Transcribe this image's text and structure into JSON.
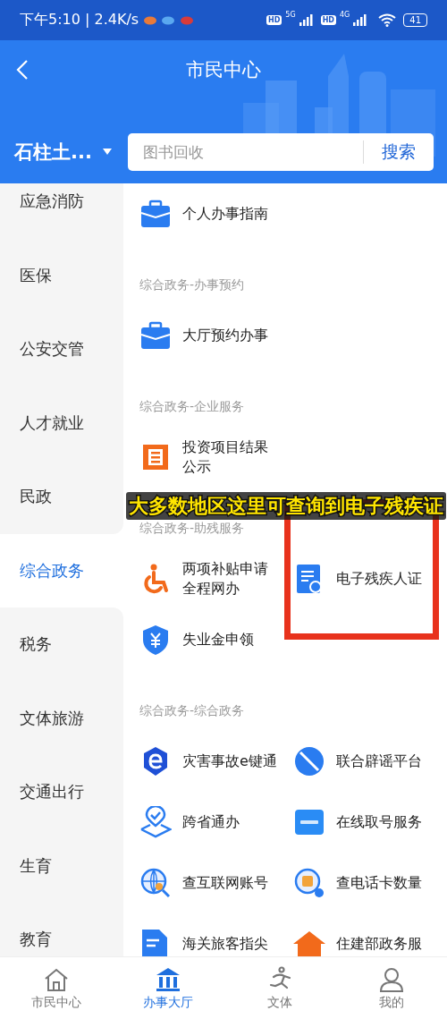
{
  "status_bar": {
    "time": "下午5:10 | 2.4K/s",
    "sim1_badge": "HD",
    "sim1_network": "5G",
    "sim2_badge": "HD",
    "sim2_network": "4G",
    "battery": "41"
  },
  "header": {
    "title": "市民中心",
    "location": "石柱土...",
    "search": {
      "placeholder": "图书回收",
      "button": "搜索"
    }
  },
  "sidebar": [
    {
      "label": "应急消防",
      "selected": false
    },
    {
      "label": "医保",
      "selected": false
    },
    {
      "label": "公安交管",
      "selected": false
    },
    {
      "label": "人才就业",
      "selected": false
    },
    {
      "label": "民政",
      "selected": false
    },
    {
      "label": "综合政务",
      "selected": true
    },
    {
      "label": "税务",
      "selected": false
    },
    {
      "label": "文体旅游",
      "selected": false
    },
    {
      "label": "交通出行",
      "selected": false
    },
    {
      "label": "生育",
      "selected": false
    },
    {
      "label": "教育",
      "selected": false
    }
  ],
  "sections": [
    {
      "items": [
        {
          "label": "个人办事指南",
          "highlighted": false
        }
      ]
    },
    {
      "header": "综合政务-办事预约",
      "items": [
        {
          "label": "大厅预约办事",
          "highlighted": false
        }
      ]
    },
    {
      "header": "综合政务-企业服务",
      "items": [
        {
          "label": "投资项目结果公示",
          "highlighted": false
        }
      ]
    },
    {
      "header": "综合政务-助残服务",
      "items": [
        {
          "label": "两项补贴申请全程网办",
          "highlighted": false
        },
        {
          "label": "电子残疾人证",
          "highlighted": true
        },
        {
          "label": "失业金申领",
          "highlighted": false
        }
      ]
    },
    {
      "header": "综合政务-综合政务",
      "items": [
        {
          "label": "灾害事故e键通",
          "highlighted": false
        },
        {
          "label": "联合辟谣平台",
          "highlighted": false
        },
        {
          "label": "跨省通办",
          "highlighted": false
        },
        {
          "label": "在线取号服务",
          "highlighted": false
        },
        {
          "label": "查互联网账号",
          "highlighted": false
        },
        {
          "label": "查电话卡数量",
          "highlighted": false
        },
        {
          "label": "海关旅客指尖",
          "highlighted": false
        },
        {
          "label": "住建部政务服",
          "highlighted": false
        }
      ]
    }
  ],
  "caption": "大多数地区这里可查询到电子残疾证",
  "bottom_nav": [
    {
      "label": "市民中心",
      "selected": false
    },
    {
      "label": "办事大厅",
      "selected": true
    },
    {
      "label": "文体",
      "selected": false
    },
    {
      "label": "我的",
      "selected": false
    }
  ]
}
